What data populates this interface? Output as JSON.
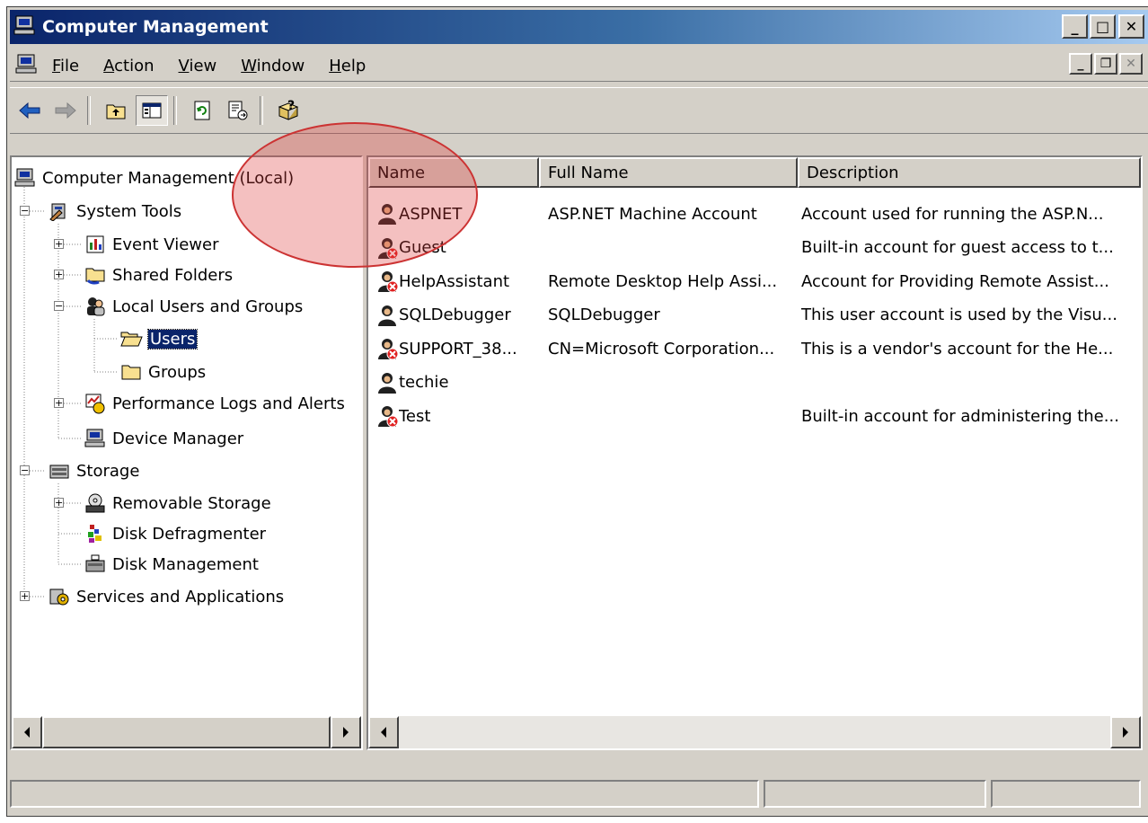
{
  "window": {
    "title": "Computer Management",
    "caption_buttons": [
      "minimize",
      "maximize",
      "close"
    ]
  },
  "menubar": {
    "items": [
      {
        "label": "File",
        "key": "F"
      },
      {
        "label": "Action",
        "key": "A"
      },
      {
        "label": "View",
        "key": "V"
      },
      {
        "label": "Window",
        "key": "W"
      },
      {
        "label": "Help",
        "key": "H"
      }
    ]
  },
  "toolbar": {
    "buttons": [
      "back-arrow-icon",
      "forward-arrow-icon",
      "up-one-level-icon",
      "show-hide-console-tree-icon",
      "refresh-icon",
      "export-list-icon",
      "help-icon"
    ]
  },
  "tree": {
    "items": [
      {
        "label": "Computer Management (Local)",
        "icon": "computer-icon"
      },
      {
        "label": "System Tools",
        "icon": "tools-icon",
        "expander": "−"
      },
      {
        "label": "Event Viewer",
        "icon": "event-viewer-icon",
        "expander": "+"
      },
      {
        "label": "Shared Folders",
        "icon": "shared-folders-icon",
        "expander": "+"
      },
      {
        "label": "Local Users and Groups",
        "icon": "users-groups-icon",
        "expander": "−"
      },
      {
        "label": "Users",
        "icon": "folder-open-icon",
        "selected": true
      },
      {
        "label": "Groups",
        "icon": "folder-icon"
      },
      {
        "label": "Performance Logs and Alerts",
        "icon": "performance-icon",
        "expander": "+"
      },
      {
        "label": "Device Manager",
        "icon": "device-manager-icon"
      },
      {
        "label": "Storage",
        "icon": "storage-icon",
        "expander": "−"
      },
      {
        "label": "Removable Storage",
        "icon": "removable-storage-icon",
        "expander": "+"
      },
      {
        "label": "Disk Defragmenter",
        "icon": "disk-defragmenter-icon"
      },
      {
        "label": "Disk Management",
        "icon": "disk-management-icon"
      },
      {
        "label": "Services and Applications",
        "icon": "services-icon",
        "expander": "+"
      }
    ]
  },
  "list": {
    "columns": [
      "Name",
      "Full Name",
      "Description"
    ],
    "rows": [
      {
        "name": "ASPNET",
        "full_name": "ASP.NET Machine Account",
        "description": "Account used for running the ASP.N...",
        "disabled": false
      },
      {
        "name": "Guest",
        "full_name": "",
        "description": "Built-in account for guest access to t...",
        "disabled": true
      },
      {
        "name": "HelpAssistant",
        "full_name": "Remote Desktop Help Assi...",
        "description": "Account for Providing Remote Assist...",
        "disabled": true
      },
      {
        "name": "SQLDebugger",
        "full_name": "SQLDebugger",
        "description": "This user account is used by the Visu...",
        "disabled": false
      },
      {
        "name": "SUPPORT_38...",
        "full_name": "CN=Microsoft Corporation...",
        "description": "This is a vendor's account for the He...",
        "disabled": true
      },
      {
        "name": "techie",
        "full_name": "",
        "description": "",
        "disabled": false
      },
      {
        "name": "Test",
        "full_name": "",
        "description": "Built-in account for administering the...",
        "disabled": true
      }
    ]
  },
  "statusbar": {
    "panels": [
      "",
      "",
      ""
    ]
  },
  "colors": {
    "title_gradient_start": "#0a246a",
    "title_gradient_end": "#a6caf0",
    "selection": "#0a246a",
    "face": "#d4d0c8",
    "highlight_overlay": "#dc3c3c"
  }
}
